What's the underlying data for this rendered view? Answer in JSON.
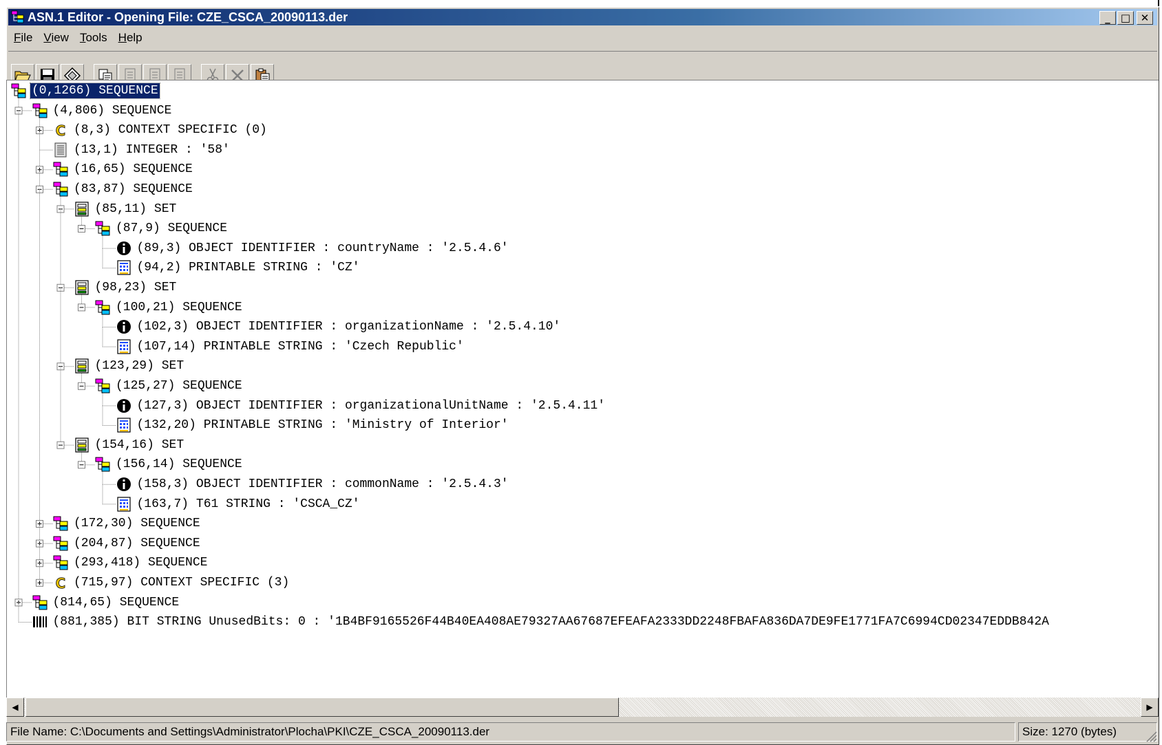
{
  "window": {
    "title": "ASN.1 Editor - Opening File: CZE_CSCA_20090113.der"
  },
  "menu": [
    {
      "label": "File"
    },
    {
      "label": "View"
    },
    {
      "label": "Tools"
    },
    {
      "label": "Help"
    }
  ],
  "toolbar": {
    "icons": [
      "open-icon",
      "save-icon",
      "export-icon",
      "copy-icon",
      "paste-hex-icon",
      "paste-text-icon",
      "paste-node-icon",
      "cut-icon",
      "delete-icon",
      "paste-icon"
    ]
  },
  "tree": {
    "nodes": [
      {
        "depth": 0,
        "expander": "none",
        "icon": "sequence-icon",
        "label": "(0,1266) SEQUENCE",
        "selected": true
      },
      {
        "depth": 1,
        "expander": "minus",
        "icon": "sequence-icon",
        "label": "(4,806) SEQUENCE"
      },
      {
        "depth": 2,
        "expander": "plus",
        "icon": "context-icon",
        "label": "(8,3) CONTEXT SPECIFIC (0)"
      },
      {
        "depth": 2,
        "expander": "none",
        "icon": "integer-icon",
        "label": "(13,1) INTEGER : '58'"
      },
      {
        "depth": 2,
        "expander": "plus",
        "icon": "sequence-icon",
        "label": "(16,65) SEQUENCE"
      },
      {
        "depth": 2,
        "expander": "minus",
        "icon": "sequence-icon",
        "label": "(83,87) SEQUENCE"
      },
      {
        "depth": 3,
        "expander": "minus",
        "icon": "set-icon",
        "label": "(85,11) SET"
      },
      {
        "depth": 4,
        "expander": "minus",
        "icon": "sequence-icon",
        "label": "(87,9) SEQUENCE"
      },
      {
        "depth": 5,
        "expander": "none",
        "icon": "oid-icon",
        "label": "(89,3) OBJECT IDENTIFIER : countryName : '2.5.4.6'"
      },
      {
        "depth": 5,
        "expander": "none",
        "icon": "string-icon",
        "label": "(94,2) PRINTABLE STRING : 'CZ'"
      },
      {
        "depth": 3,
        "expander": "minus",
        "icon": "set-icon",
        "label": "(98,23) SET"
      },
      {
        "depth": 4,
        "expander": "minus",
        "icon": "sequence-icon",
        "label": "(100,21) SEQUENCE"
      },
      {
        "depth": 5,
        "expander": "none",
        "icon": "oid-icon",
        "label": "(102,3) OBJECT IDENTIFIER : organizationName : '2.5.4.10'"
      },
      {
        "depth": 5,
        "expander": "none",
        "icon": "string-icon",
        "label": "(107,14) PRINTABLE STRING : 'Czech Republic'"
      },
      {
        "depth": 3,
        "expander": "minus",
        "icon": "set-icon",
        "label": "(123,29) SET"
      },
      {
        "depth": 4,
        "expander": "minus",
        "icon": "sequence-icon",
        "label": "(125,27) SEQUENCE"
      },
      {
        "depth": 5,
        "expander": "none",
        "icon": "oid-icon",
        "label": "(127,3) OBJECT IDENTIFIER : organizationalUnitName : '2.5.4.11'"
      },
      {
        "depth": 5,
        "expander": "none",
        "icon": "string-icon",
        "label": "(132,20) PRINTABLE STRING : 'Ministry of Interior'"
      },
      {
        "depth": 3,
        "expander": "minus",
        "icon": "set-icon",
        "label": "(154,16) SET"
      },
      {
        "depth": 4,
        "expander": "minus",
        "icon": "sequence-icon",
        "label": "(156,14) SEQUENCE"
      },
      {
        "depth": 5,
        "expander": "none",
        "icon": "oid-icon",
        "label": "(158,3) OBJECT IDENTIFIER : commonName : '2.5.4.3'"
      },
      {
        "depth": 5,
        "expander": "none",
        "icon": "string-icon",
        "label": "(163,7) T61 STRING : 'CSCA_CZ'"
      },
      {
        "depth": 2,
        "expander": "plus",
        "icon": "sequence-icon",
        "label": "(172,30) SEQUENCE"
      },
      {
        "depth": 2,
        "expander": "plus",
        "icon": "sequence-icon",
        "label": "(204,87) SEQUENCE"
      },
      {
        "depth": 2,
        "expander": "plus",
        "icon": "sequence-icon",
        "label": "(293,418) SEQUENCE"
      },
      {
        "depth": 2,
        "expander": "plus",
        "icon": "context-icon",
        "label": "(715,97) CONTEXT SPECIFIC (3)"
      },
      {
        "depth": 1,
        "expander": "plus",
        "icon": "sequence-icon",
        "label": "(814,65) SEQUENCE"
      },
      {
        "depth": 1,
        "expander": "none",
        "icon": "bitstring-icon",
        "label": "(881,385) BIT STRING UnusedBits: 0 : '1B4BF9165526F44B40EA408AE79327AA67687EFEAFA2333DD2248FBAFA836DA7DE9FE1771FA7C6994CD02347EDDB842A"
      }
    ]
  },
  "statusbar": {
    "file_name": "File Name: C:\\Documents and Settings\\Administrator\\Plocha\\PKI\\CZE_CSCA_20090113.der",
    "size": "Size: 1270 (bytes)"
  }
}
